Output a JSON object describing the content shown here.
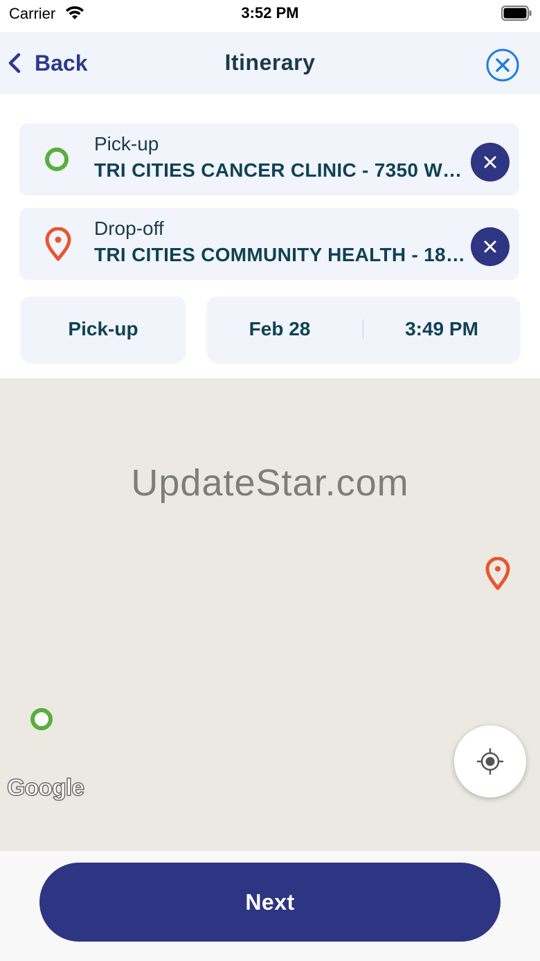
{
  "status_bar": {
    "carrier": "Carrier",
    "time": "3:52 PM",
    "icons": [
      "wifi-icon",
      "battery-icon"
    ]
  },
  "nav": {
    "back_label": "Back",
    "title": "Itinerary",
    "close_icon": "close-circle-icon"
  },
  "pickup": {
    "title": "Pick-up",
    "address": "TRI CITIES CANCER CLINIC - 7350 W DE...",
    "icon": "pickup-ring-icon",
    "icon_color": "#5aad3e"
  },
  "dropoff": {
    "title": "Drop-off",
    "address": "TRI CITIES COMMUNITY HEALTH - 180...",
    "icon": "dropoff-pin-icon",
    "icon_color": "#e8552f"
  },
  "schedule": {
    "mode_label": "Pick-up",
    "date": "Feb 28",
    "time": "3:49 PM"
  },
  "map": {
    "watermark": "UpdateStar.com",
    "attribution": "Google",
    "locate_icon": "locate-me-icon"
  },
  "footer": {
    "next_label": "Next"
  },
  "colors": {
    "primary": "#2e3582",
    "back_blue": "#2b3b8c",
    "close_blue": "#1e7de0",
    "card_bg": "#f1f4fb",
    "map_bg": "#ece9e2",
    "text_dark": "#0f4254"
  }
}
